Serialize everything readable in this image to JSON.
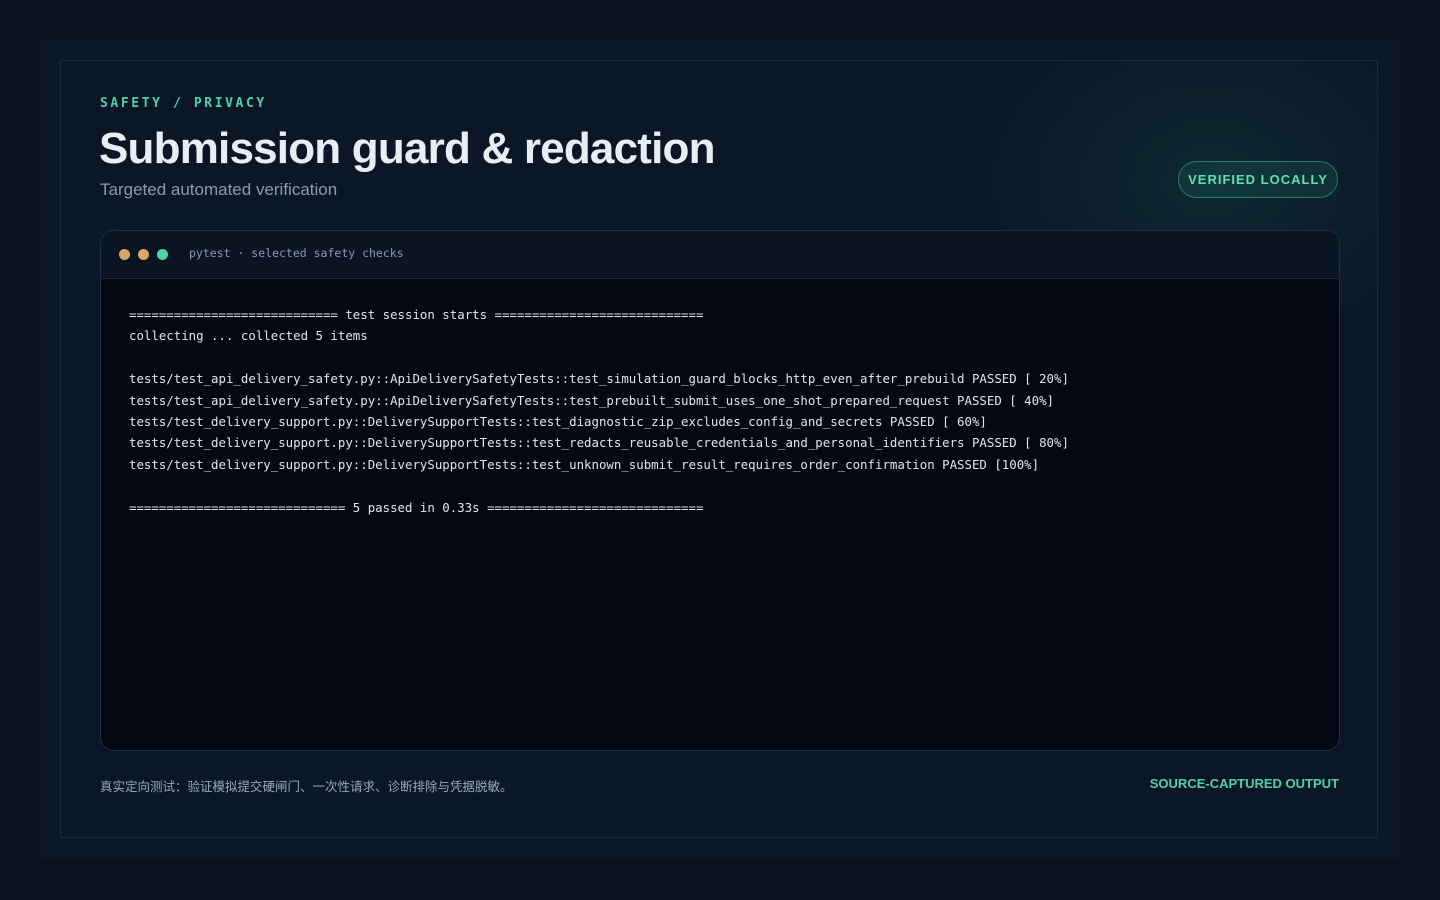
{
  "header": {
    "eyebrow": "SAFETY / PRIVACY",
    "title": "Submission guard & redaction",
    "subtitle": "Targeted automated verification",
    "badge": "VERIFIED LOCALLY"
  },
  "terminal": {
    "title": "pytest · selected safety checks",
    "dots": [
      "#d9a66b",
      "#d9a66b",
      "#4fd1a5"
    ],
    "lines": [
      "============================ test session starts ============================",
      "collecting ... collected 5 items",
      "",
      "tests/test_api_delivery_safety.py::ApiDeliverySafetyTests::test_simulation_guard_blocks_http_even_after_prebuild PASSED [ 20%]",
      "tests/test_api_delivery_safety.py::ApiDeliverySafetyTests::test_prebuilt_submit_uses_one_shot_prepared_request PASSED [ 40%]",
      "tests/test_delivery_support.py::DeliverySupportTests::test_diagnostic_zip_excludes_config_and_secrets PASSED [ 60%]",
      "tests/test_delivery_support.py::DeliverySupportTests::test_redacts_reusable_credentials_and_personal_identifiers PASSED [ 80%]",
      "tests/test_delivery_support.py::DeliverySupportTests::test_unknown_submit_result_requires_order_confirmation PASSED [100%]",
      "",
      "============================= 5 passed in 0.33s ============================="
    ]
  },
  "footer": {
    "note": "真实定向测试：验证模拟提交硬闸门、一次性请求、诊断排除与凭据脱敏。",
    "tag": "SOURCE-CAPTURED OUTPUT"
  },
  "colors": {
    "accent": "#4fd1a5",
    "background": "#0a1220",
    "panel": "#0b1727",
    "terminal_bg": "#030812"
  }
}
